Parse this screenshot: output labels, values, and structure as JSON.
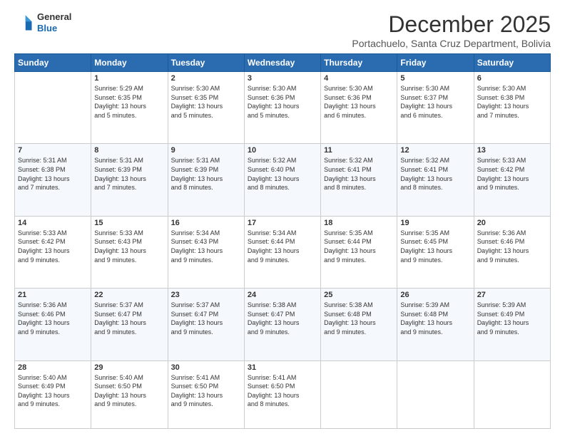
{
  "logo": {
    "line1": "General",
    "line2": "Blue"
  },
  "title": "December 2025",
  "subtitle": "Portachuelo, Santa Cruz Department, Bolivia",
  "weekdays": [
    "Sunday",
    "Monday",
    "Tuesday",
    "Wednesday",
    "Thursday",
    "Friday",
    "Saturday"
  ],
  "weeks": [
    [
      {
        "day": "",
        "info": ""
      },
      {
        "day": "1",
        "info": "Sunrise: 5:29 AM\nSunset: 6:35 PM\nDaylight: 13 hours\nand 5 minutes."
      },
      {
        "day": "2",
        "info": "Sunrise: 5:30 AM\nSunset: 6:35 PM\nDaylight: 13 hours\nand 5 minutes."
      },
      {
        "day": "3",
        "info": "Sunrise: 5:30 AM\nSunset: 6:36 PM\nDaylight: 13 hours\nand 5 minutes."
      },
      {
        "day": "4",
        "info": "Sunrise: 5:30 AM\nSunset: 6:36 PM\nDaylight: 13 hours\nand 6 minutes."
      },
      {
        "day": "5",
        "info": "Sunrise: 5:30 AM\nSunset: 6:37 PM\nDaylight: 13 hours\nand 6 minutes."
      },
      {
        "day": "6",
        "info": "Sunrise: 5:30 AM\nSunset: 6:38 PM\nDaylight: 13 hours\nand 7 minutes."
      }
    ],
    [
      {
        "day": "7",
        "info": "Sunrise: 5:31 AM\nSunset: 6:38 PM\nDaylight: 13 hours\nand 7 minutes."
      },
      {
        "day": "8",
        "info": "Sunrise: 5:31 AM\nSunset: 6:39 PM\nDaylight: 13 hours\nand 7 minutes."
      },
      {
        "day": "9",
        "info": "Sunrise: 5:31 AM\nSunset: 6:39 PM\nDaylight: 13 hours\nand 8 minutes."
      },
      {
        "day": "10",
        "info": "Sunrise: 5:32 AM\nSunset: 6:40 PM\nDaylight: 13 hours\nand 8 minutes."
      },
      {
        "day": "11",
        "info": "Sunrise: 5:32 AM\nSunset: 6:41 PM\nDaylight: 13 hours\nand 8 minutes."
      },
      {
        "day": "12",
        "info": "Sunrise: 5:32 AM\nSunset: 6:41 PM\nDaylight: 13 hours\nand 8 minutes."
      },
      {
        "day": "13",
        "info": "Sunrise: 5:33 AM\nSunset: 6:42 PM\nDaylight: 13 hours\nand 9 minutes."
      }
    ],
    [
      {
        "day": "14",
        "info": "Sunrise: 5:33 AM\nSunset: 6:42 PM\nDaylight: 13 hours\nand 9 minutes."
      },
      {
        "day": "15",
        "info": "Sunrise: 5:33 AM\nSunset: 6:43 PM\nDaylight: 13 hours\nand 9 minutes."
      },
      {
        "day": "16",
        "info": "Sunrise: 5:34 AM\nSunset: 6:43 PM\nDaylight: 13 hours\nand 9 minutes."
      },
      {
        "day": "17",
        "info": "Sunrise: 5:34 AM\nSunset: 6:44 PM\nDaylight: 13 hours\nand 9 minutes."
      },
      {
        "day": "18",
        "info": "Sunrise: 5:35 AM\nSunset: 6:44 PM\nDaylight: 13 hours\nand 9 minutes."
      },
      {
        "day": "19",
        "info": "Sunrise: 5:35 AM\nSunset: 6:45 PM\nDaylight: 13 hours\nand 9 minutes."
      },
      {
        "day": "20",
        "info": "Sunrise: 5:36 AM\nSunset: 6:46 PM\nDaylight: 13 hours\nand 9 minutes."
      }
    ],
    [
      {
        "day": "21",
        "info": "Sunrise: 5:36 AM\nSunset: 6:46 PM\nDaylight: 13 hours\nand 9 minutes."
      },
      {
        "day": "22",
        "info": "Sunrise: 5:37 AM\nSunset: 6:47 PM\nDaylight: 13 hours\nand 9 minutes."
      },
      {
        "day": "23",
        "info": "Sunrise: 5:37 AM\nSunset: 6:47 PM\nDaylight: 13 hours\nand 9 minutes."
      },
      {
        "day": "24",
        "info": "Sunrise: 5:38 AM\nSunset: 6:47 PM\nDaylight: 13 hours\nand 9 minutes."
      },
      {
        "day": "25",
        "info": "Sunrise: 5:38 AM\nSunset: 6:48 PM\nDaylight: 13 hours\nand 9 minutes."
      },
      {
        "day": "26",
        "info": "Sunrise: 5:39 AM\nSunset: 6:48 PM\nDaylight: 13 hours\nand 9 minutes."
      },
      {
        "day": "27",
        "info": "Sunrise: 5:39 AM\nSunset: 6:49 PM\nDaylight: 13 hours\nand 9 minutes."
      }
    ],
    [
      {
        "day": "28",
        "info": "Sunrise: 5:40 AM\nSunset: 6:49 PM\nDaylight: 13 hours\nand 9 minutes."
      },
      {
        "day": "29",
        "info": "Sunrise: 5:40 AM\nSunset: 6:50 PM\nDaylight: 13 hours\nand 9 minutes."
      },
      {
        "day": "30",
        "info": "Sunrise: 5:41 AM\nSunset: 6:50 PM\nDaylight: 13 hours\nand 9 minutes."
      },
      {
        "day": "31",
        "info": "Sunrise: 5:41 AM\nSunset: 6:50 PM\nDaylight: 13 hours\nand 8 minutes."
      },
      {
        "day": "",
        "info": ""
      },
      {
        "day": "",
        "info": ""
      },
      {
        "day": "",
        "info": ""
      }
    ]
  ]
}
